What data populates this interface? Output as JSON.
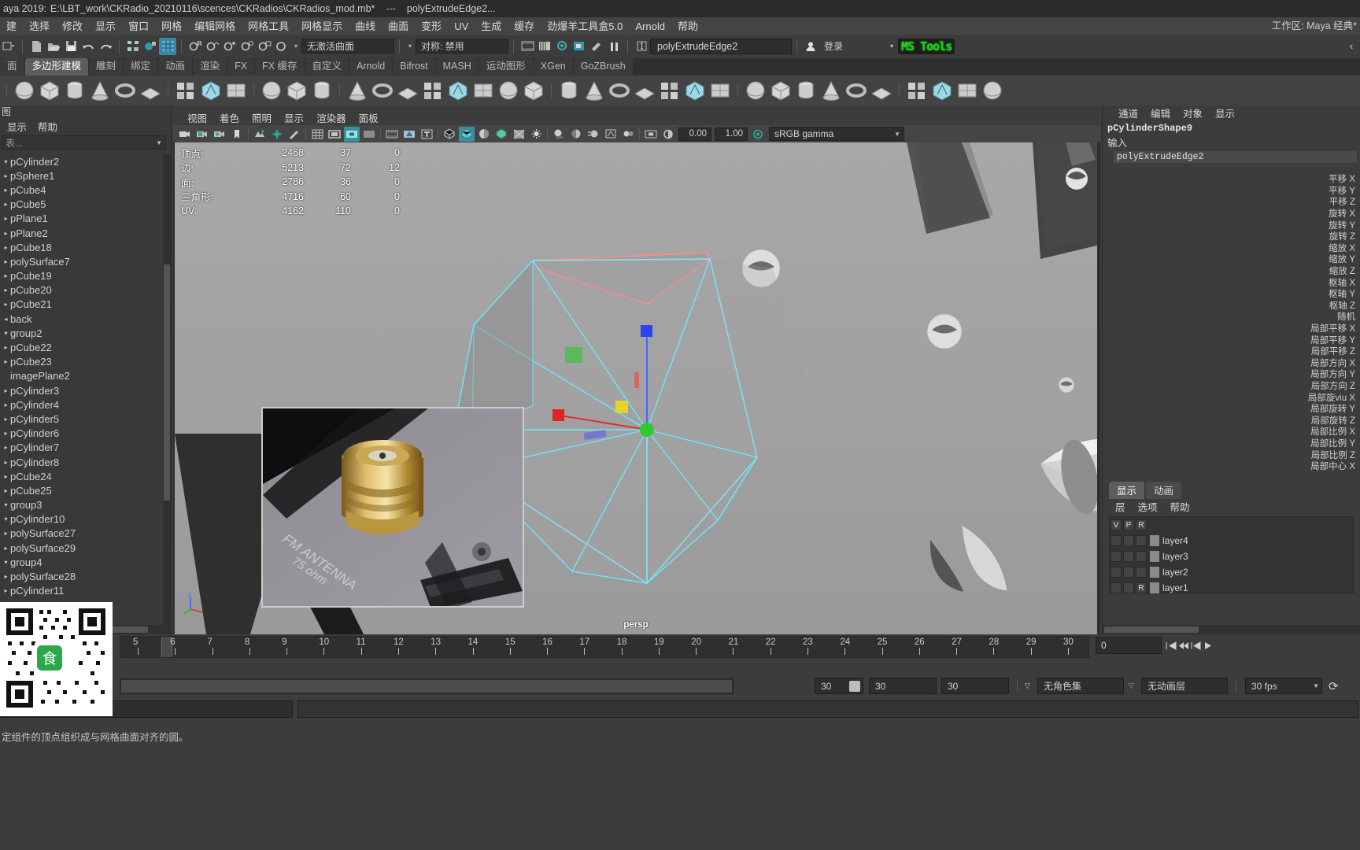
{
  "window": {
    "title_prefix": "aya 2019:",
    "file_path": "E:\\LBT_work\\CKRadio_20210116\\scences\\CKRadios\\CKRadios_mod.mb*",
    "separator": "---",
    "node_name": "polyExtrudeEdge2..."
  },
  "menubar": {
    "items": [
      "建",
      "选择",
      "修改",
      "显示",
      "窗口",
      "网格",
      "编辑网格",
      "网格工具",
      "网格显示",
      "曲线",
      "曲面",
      "变形",
      "UV",
      "生成",
      "缓存",
      "劲爆羊工具盒5.0",
      "Arnold",
      "帮助"
    ],
    "workspace_label": "工作区: Maya 经典*"
  },
  "statusline": {
    "surface_combo": "无激活曲面",
    "symmetry_combo": "对称: 禁用",
    "selected_node": "polyExtrudeEdge2",
    "login_label": "登录",
    "brand": "MS Tools",
    "icons": [
      "selection-mode-dropdown",
      "new-scene-icon",
      "open-scene-icon",
      "save-scene-icon",
      "undo-icon",
      "redo-icon",
      "select-by-hierarchy-icon",
      "select-by-object-icon",
      "select-by-component-icon",
      "snap-grid-icon",
      "snap-curve-icon",
      "snap-point-icon",
      "snap-projected-icon",
      "snap-view-plane-icon",
      "snap-construction-icon",
      "render-current-frame-icon",
      "ipr-render-icon",
      "render-settings-icon",
      "pause-render-icon",
      "input-field-icon"
    ]
  },
  "shelf": {
    "tabs": [
      "面",
      "多边形建模",
      "雕刻",
      "绑定",
      "动画",
      "渲染",
      "FX",
      "FX 缓存",
      "自定义",
      "Arnold",
      "Bifrost",
      "MASH",
      "运动图形",
      "XGen",
      "GoZBrush"
    ],
    "active_tab": "多边形建模",
    "icons": [
      "poly-sphere-icon",
      "poly-cube-icon",
      "poly-cylinder-icon",
      "poly-cone-icon",
      "poly-torus-icon",
      "poly-plane-icon",
      "poly-primitives-icon",
      "poly-type-icon",
      "poly-svg-icon",
      "poly-helix-icon",
      "poly-soccer-icon",
      "poly-platonic-icon",
      "poly-sweep-icon",
      "combine-icon",
      "separate-icon",
      "booleans-icon",
      "smooth-icon",
      "bridge-icon",
      "extrude-icon",
      "wedge-icon",
      "chamfer-icon",
      "bevel-icon",
      "merge-icon",
      "multicut-icon",
      "target-weld-icon",
      "quad-draw-icon",
      "connect-icon",
      "detach-icon",
      "append-polygon-icon",
      "poke-icon",
      "offset-edge-icon",
      "mirror-icon",
      "circularize-icon",
      "spin-edge-icon",
      "crease-icon",
      "transfer-attributes-icon",
      "display-all-icon"
    ]
  },
  "outliner": {
    "title": "图",
    "menus": [
      "显示",
      "帮助"
    ],
    "search_placeholder": "表...",
    "items": [
      {
        "label": "pCylinder2",
        "arrow": "down"
      },
      {
        "label": "pSphere1",
        "arrow": "right"
      },
      {
        "label": "pCube4",
        "arrow": "right"
      },
      {
        "label": "pCube5",
        "arrow": "right"
      },
      {
        "label": "pPlane1",
        "arrow": "right"
      },
      {
        "label": "pPlane2",
        "arrow": "right"
      },
      {
        "label": "pCube18",
        "arrow": "right"
      },
      {
        "label": "polySurface7",
        "arrow": "right"
      },
      {
        "label": "pCube19",
        "arrow": "right"
      },
      {
        "label": "pCube20",
        "arrow": "right"
      },
      {
        "label": "pCube21",
        "arrow": "right"
      },
      {
        "label": "back",
        "arrow": "left"
      },
      {
        "label": "group2",
        "arrow": "down"
      },
      {
        "label": "pCube22",
        "arrow": "right"
      },
      {
        "label": "pCube23",
        "arrow": "right"
      },
      {
        "label": "imagePlane2",
        "arrow": "none"
      },
      {
        "label": "pCylinder3",
        "arrow": "right"
      },
      {
        "label": "pCylinder4",
        "arrow": "right"
      },
      {
        "label": "pCylinder5",
        "arrow": "right"
      },
      {
        "label": "pCylinder6",
        "arrow": "right"
      },
      {
        "label": "pCylinder7",
        "arrow": "right"
      },
      {
        "label": "pCylinder8",
        "arrow": "right"
      },
      {
        "label": "pCube24",
        "arrow": "right"
      },
      {
        "label": "pCube25",
        "arrow": "right"
      },
      {
        "label": "group3",
        "arrow": "down"
      },
      {
        "label": "pCylinder10",
        "arrow": "down"
      },
      {
        "label": "polySurface27",
        "arrow": "right"
      },
      {
        "label": "polySurface29",
        "arrow": "right"
      },
      {
        "label": "group4",
        "arrow": "down"
      },
      {
        "label": "polySurface28",
        "arrow": "right"
      },
      {
        "label": "pCylinder11",
        "arrow": "right"
      }
    ]
  },
  "viewport": {
    "menus": [
      "视图",
      "着色",
      "照明",
      "显示",
      "渲染器",
      "面板"
    ],
    "exposure": "0.00",
    "gamma": "1.00",
    "colorspace": "sRGB gamma",
    "camera_label": "persp",
    "hud": {
      "rows": [
        {
          "label": "顶点:",
          "c1": "2468",
          "c2": "37",
          "c3": "0"
        },
        {
          "label": "边:",
          "c1": "5213",
          "c2": "72",
          "c3": "12"
        },
        {
          "label": "面:",
          "c1": "2786",
          "c2": "36",
          "c3": "0"
        },
        {
          "label": "三角形:",
          "c1": "4716",
          "c2": "60",
          "c3": "0"
        },
        {
          "label": "UV:",
          "c1": "4162",
          "c2": "110",
          "c3": "0"
        }
      ]
    }
  },
  "channelbox": {
    "menus": [
      "通道",
      "编辑",
      "对象",
      "显示"
    ],
    "shape_name": "pCylinderShape9",
    "inputs_label": "输入",
    "input_node": "polyExtrudeEdge2",
    "attributes": [
      "平移 X",
      "平移 Y",
      "平移 Z",
      "旋转 X",
      "旋转 Y",
      "旋转 Z",
      "缩放 X",
      "缩放 Y",
      "缩放 Z",
      "枢轴 X",
      "枢轴 Y",
      "枢轴 Z",
      "随机",
      "局部平移 X",
      "局部平移 Y",
      "局部平移 Z",
      "局部方向 X",
      "局部方向 Y",
      "局部方向 Z",
      "局部旋viu X",
      "局部旋转 Y",
      "局部旋转 Z",
      "局部比例 X",
      "局部比例 Y",
      "局部比例 Z",
      "局部中心 X"
    ]
  },
  "layers": {
    "tabs": [
      "显示",
      "动画"
    ],
    "active_tab": "显示",
    "menus": [
      "层",
      "选项",
      "帮助"
    ],
    "col_headers": [
      "V",
      "P",
      "R"
    ],
    "rows": [
      {
        "v": "",
        "p": "",
        "r": "",
        "name": "layer4"
      },
      {
        "v": "",
        "p": "",
        "r": "",
        "name": "layer3"
      },
      {
        "v": "",
        "p": "",
        "r": "",
        "name": "layer2"
      },
      {
        "v": "",
        "p": "",
        "r": "R",
        "name": "layer1"
      }
    ]
  },
  "timeline": {
    "ticks": [
      "5",
      "6",
      "7",
      "8",
      "9",
      "10",
      "11",
      "12",
      "13",
      "14",
      "15",
      "16",
      "17",
      "18",
      "19",
      "20",
      "21",
      "22",
      "23",
      "24",
      "25",
      "26",
      "27",
      "28",
      "29",
      "30"
    ],
    "current_frame": "0",
    "playback_buttons": [
      "go-to-start-icon",
      "step-back-icon",
      "play-back-icon",
      "play-forward-icon"
    ]
  },
  "rangebar": {
    "start_field": "30",
    "anim_start": "30",
    "anim_end": "30",
    "character_set": "无角色集",
    "anim_layer": "无动画层",
    "fps": "30 fps",
    "loop_icon": "loop-icon"
  },
  "status": {
    "help_text": "定组件的顶点组织成与网格曲面对齐的圆。"
  }
}
